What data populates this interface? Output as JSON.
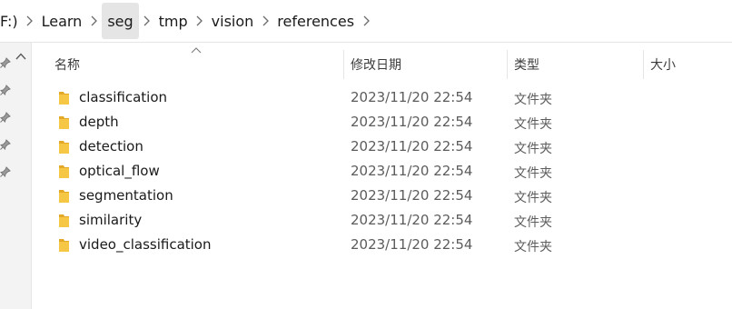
{
  "breadcrumb": {
    "drive_fragment": "F:)",
    "items": [
      "Learn",
      "seg",
      "tmp",
      "vision",
      "references"
    ]
  },
  "columns": {
    "name": "名称",
    "date": "修改日期",
    "type": "类型",
    "size": "大小"
  },
  "rows": [
    {
      "name": "classification",
      "date": "2023/11/20 22:54",
      "type": "文件夹"
    },
    {
      "name": "depth",
      "date": "2023/11/20 22:54",
      "type": "文件夹"
    },
    {
      "name": "detection",
      "date": "2023/11/20 22:54",
      "type": "文件夹"
    },
    {
      "name": "optical_flow",
      "date": "2023/11/20 22:54",
      "type": "文件夹"
    },
    {
      "name": "segmentation",
      "date": "2023/11/20 22:54",
      "type": "文件夹"
    },
    {
      "name": "similarity",
      "date": "2023/11/20 22:54",
      "type": "文件夹"
    },
    {
      "name": "video_classification",
      "date": "2023/11/20 22:54",
      "type": "文件夹"
    }
  ],
  "colors": {
    "folder_yellow": "#f6c744",
    "folder_dark": "#e3a825",
    "crumb_highlight": "#e5e5e5"
  },
  "icons": {
    "separator": "chevron-right-icon",
    "folder": "folder-icon",
    "pin": "pin-icon",
    "sort": "sort-ascending-icon",
    "scroll_up": "scroll-up-icon"
  }
}
